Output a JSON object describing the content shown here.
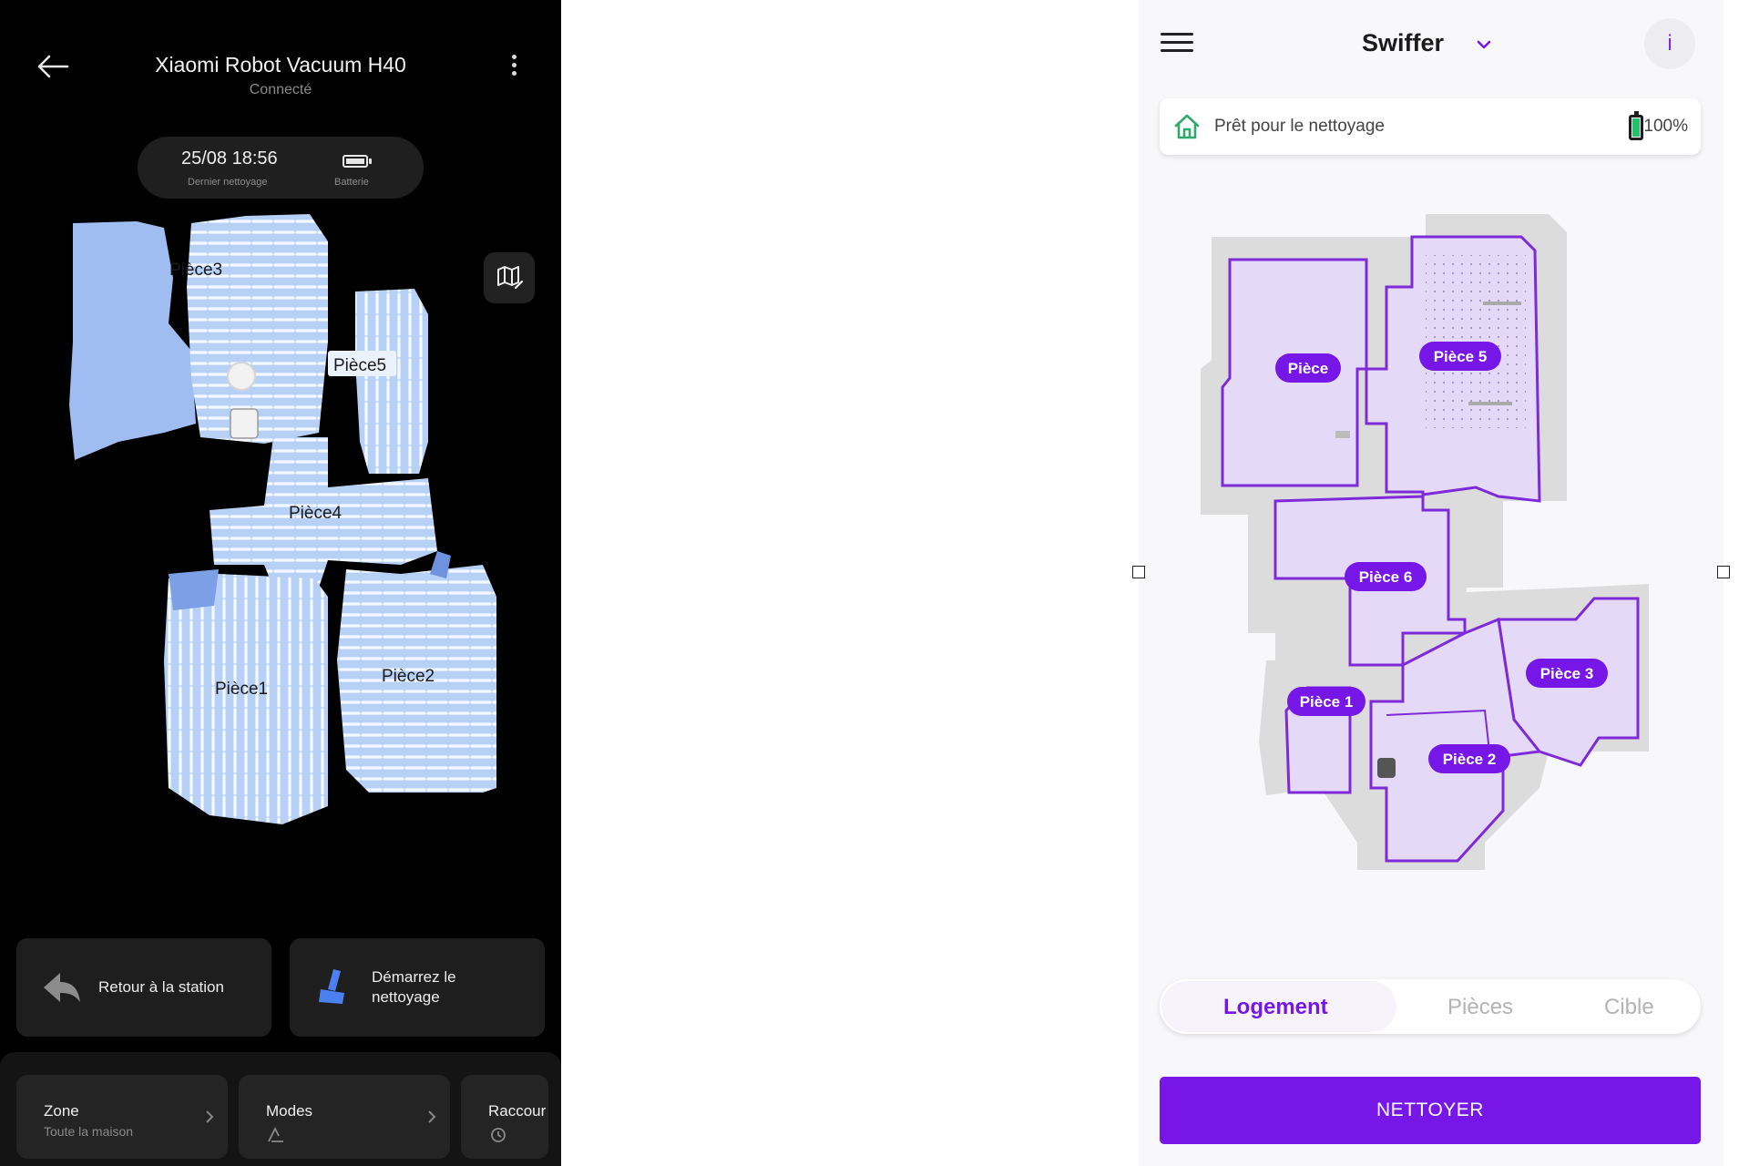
{
  "xiaomi": {
    "title": "Xiaomi Robot Vacuum H40",
    "subtitle": "Connecté",
    "last_clean_value": "25/08 18:56",
    "last_clean_caption": "Dernier nettoyage",
    "battery_caption": "Batterie",
    "rooms": [
      "Pièce3",
      "Pièce5",
      "Pièce4",
      "Pièce1",
      "Pièce2"
    ],
    "return_label_line1": "Retour à la station",
    "start_label_line1": "Démarrez le",
    "start_label_line2": "nettoyage",
    "tiles": [
      {
        "title": "Zone",
        "sub": "Toute la maison"
      },
      {
        "title": "Modes",
        "sub": ""
      },
      {
        "title": "Raccour",
        "sub": ""
      }
    ],
    "colors": {
      "map_fill": "#a9c6f2",
      "map_dark": "#7c9fe6",
      "start_icon": "#4c7ff0"
    }
  },
  "swiffer": {
    "title": "Swiffer",
    "info_label": "i",
    "status": "Prêt pour le nettoyage",
    "battery": "100%",
    "rooms": [
      "Pièce",
      "Pièce 5",
      "Pièce 6",
      "Pièce 3",
      "Pièce 1",
      "Pièce 2"
    ],
    "tabs": [
      {
        "label": "Logement",
        "active": true
      },
      {
        "label": "Pièces",
        "active": false
      },
      {
        "label": "Cible",
        "active": false
      }
    ],
    "clean_button": "NETTOYER",
    "colors": {
      "accent": "#7617e8",
      "room_fill": "#e4d9f7",
      "room_stroke": "#7e2ad8",
      "home_icon": "#2faa6a",
      "battery_fill": "#22c06a"
    }
  }
}
